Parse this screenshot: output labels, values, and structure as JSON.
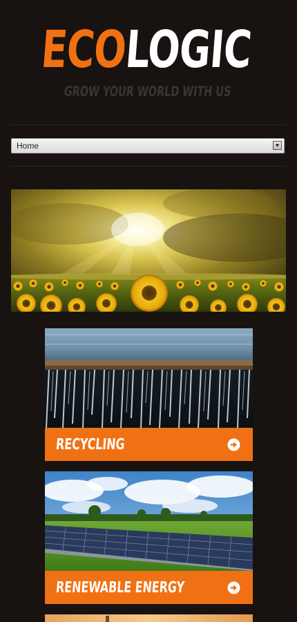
{
  "brand": {
    "logo_part1": "ECO",
    "logo_part2": "LOGIC",
    "tagline": "GROW YOUR WORLD WITH US",
    "accent_color": "#f07114",
    "background_color": "#181210"
  },
  "nav": {
    "selected": "Home",
    "arrow_icon": "chevron-down-icon"
  },
  "hero": {
    "image_alt": "sunflower-field-image"
  },
  "cards": [
    {
      "title": "RECYCLING",
      "image": "waterfall-image",
      "icon": "arrow-right-circle-icon"
    },
    {
      "title": "RENEWABLE ENERGY",
      "image": "solar-panels-image",
      "icon": "arrow-right-circle-icon"
    },
    {
      "title": "",
      "image": "sunset-image",
      "icon": ""
    }
  ]
}
